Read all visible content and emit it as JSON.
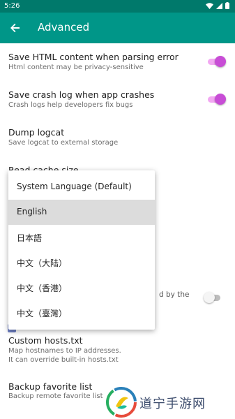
{
  "status_bar": {
    "time": "5:26"
  },
  "app_bar": {
    "title": "Advanced"
  },
  "settings": [
    {
      "title": "Save HTML content when parsing error",
      "subtitle": "Html content may be privacy-sensitive",
      "toggle": true
    },
    {
      "title": "Save crash log when app crashes",
      "subtitle": "Crash logs help developers fix bugs",
      "toggle": true
    },
    {
      "title": "Dump logcat",
      "subtitle": "Save logcat to external storage"
    },
    {
      "title": "Read cache size"
    },
    {
      "subtitle_partial": "d by the",
      "toggle": false
    },
    {
      "title": "Custom hosts.txt",
      "subtitle_line1": "Map hostnames to IP addresses.",
      "subtitle_line2": "It can override built-in hosts.txt"
    },
    {
      "title": "Backup favorite list",
      "subtitle": "Backup remote favorite list"
    }
  ],
  "language_menu": {
    "selected": "English",
    "options": [
      "System Language (Default)",
      "English",
      "日本語",
      "中文（大陆）",
      "中文（香港）",
      "中文（臺灣）"
    ]
  },
  "watermark": {
    "text": "道宁手游网"
  },
  "colors": {
    "statusbar": "#00796b",
    "appbar": "#009688",
    "switch_on": "#c84dd6",
    "switch_track_on": "#f2a7f2"
  }
}
